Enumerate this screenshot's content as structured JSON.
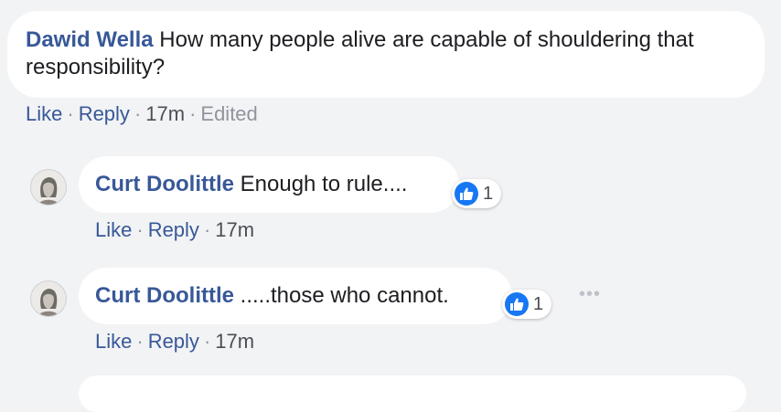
{
  "comment": {
    "author": "Dawid Wella",
    "text": "How many people alive are capable of shouldering that responsibility?",
    "actions": {
      "like": "Like",
      "reply": "Reply",
      "time": "17m",
      "edited": "Edited"
    }
  },
  "replies": [
    {
      "author": "Curt Doolittle",
      "text": "Enough to rule....",
      "reaction": {
        "icon": "thumbs-up-icon",
        "count": "1"
      },
      "actions": {
        "like": "Like",
        "reply": "Reply",
        "time": "17m"
      }
    },
    {
      "author": "Curt Doolittle",
      "text": ".....those who cannot.",
      "reaction": {
        "icon": "thumbs-up-icon",
        "count": "1"
      },
      "more": "•••",
      "actions": {
        "like": "Like",
        "reply": "Reply",
        "time": "17m"
      }
    }
  ],
  "colors": {
    "author": "#385898",
    "background": "#f2f3f5",
    "bubble": "#ffffff",
    "like_badge": "#1877f2",
    "meta_gray": "#90949c"
  }
}
